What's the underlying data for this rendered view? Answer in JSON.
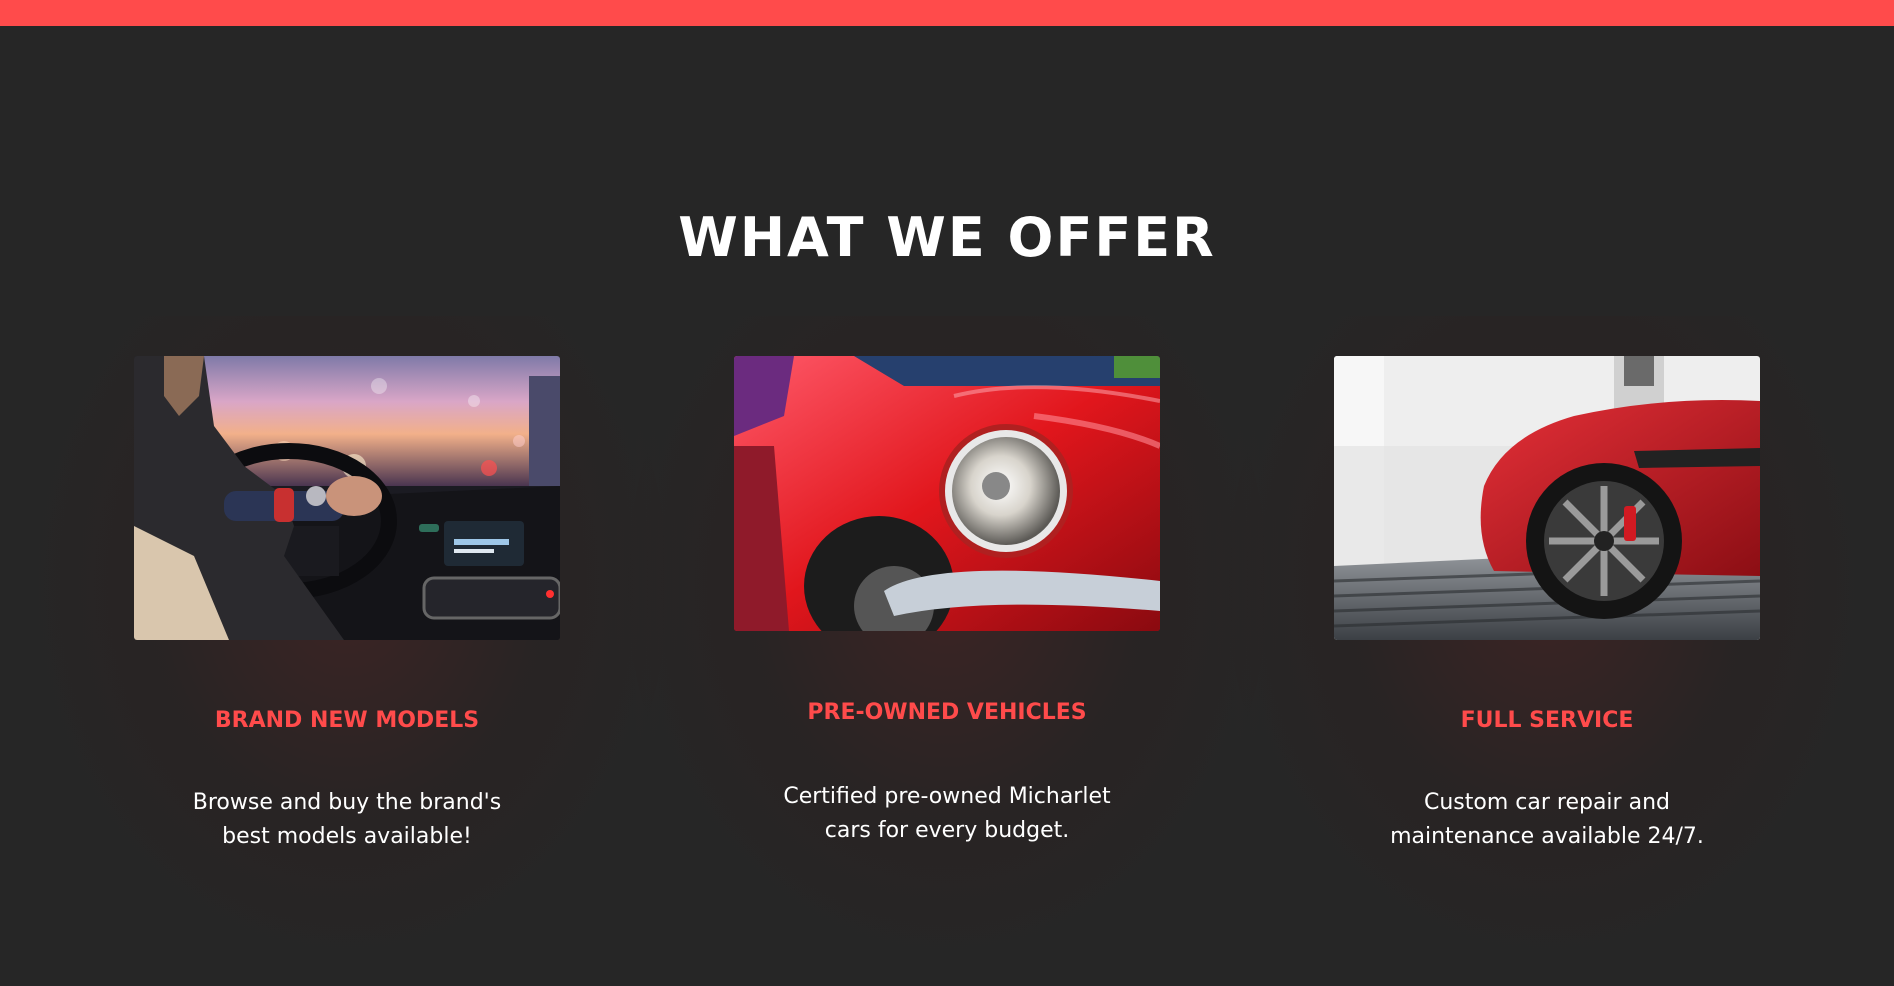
{
  "header": {
    "accent_color": "#ff4b4b"
  },
  "section": {
    "title": "WHAT WE OFFER"
  },
  "offers": [
    {
      "image_alt": "driver-steering-wheel-photo",
      "title": "BRAND NEW MODELS",
      "text": "Browse and buy the brand's best models available!"
    },
    {
      "image_alt": "red-classic-car-headlight-photo",
      "title": "PRE-OWNED VEHICLES",
      "text": "Certified pre-owned Micharlet cars for every budget."
    },
    {
      "image_alt": "red-sports-car-wheel-photo",
      "title": "FULL SERVICE",
      "text": "Custom car repair and maintenance available 24/7."
    }
  ]
}
